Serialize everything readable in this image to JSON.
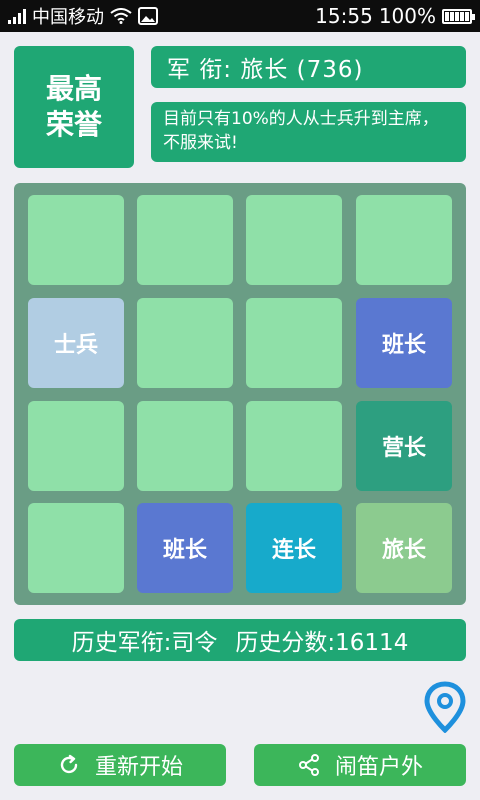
{
  "status_bar": {
    "carrier": "中国移动",
    "time": "15:55",
    "battery": "100%",
    "icons": [
      "signal-icon",
      "wifi-icon",
      "gallery-icon",
      "battery-icon"
    ]
  },
  "header": {
    "honor_line1": "最高",
    "honor_line2": "荣誉",
    "rank": "军 衔: 旅长 (736)",
    "message": "目前只有10%的人从士兵升到主席，不服来试!"
  },
  "board": {
    "rows": 4,
    "cols": 4,
    "tiles": [
      {
        "row": 2,
        "col": 1,
        "label": "士兵",
        "color": "#b1cde3"
      },
      {
        "row": 2,
        "col": 4,
        "label": "班长",
        "color": "#5a78d1"
      },
      {
        "row": 3,
        "col": 4,
        "label": "营长",
        "color": "#2d9f80"
      },
      {
        "row": 4,
        "col": 2,
        "label": "班长",
        "color": "#5a78d1"
      },
      {
        "row": 4,
        "col": 3,
        "label": "连长",
        "color": "#17aacb"
      },
      {
        "row": 4,
        "col": 4,
        "label": "旅长",
        "color": "#8ccb8f"
      }
    ],
    "empty_color": "#8fe0a8"
  },
  "history": {
    "rank_label": "历史军衔:司令",
    "score_label": "历史分数:16114"
  },
  "buttons": {
    "restart": "重新开始",
    "share": "闹笛户外"
  },
  "colors": {
    "primary": "#1fa774",
    "button": "#3cb65a",
    "board": "#6a9d85",
    "pin": "#1e90dd"
  }
}
